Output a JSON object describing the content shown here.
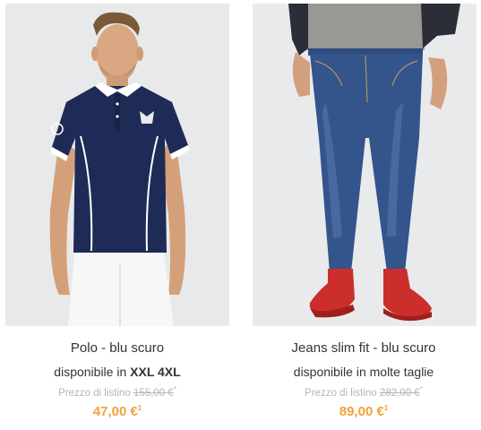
{
  "products": [
    {
      "title": "Polo - blu scuro",
      "availability_prefix": "disponibile in ",
      "availability_sizes": "XXL 4XL",
      "list_price_label": "Prezzo di listino",
      "list_price": "155,00 €",
      "list_price_mark": "*",
      "price": "47,00 €",
      "price_mark": "1",
      "image_icon": "polo-shirt-photo"
    },
    {
      "title": "Jeans slim fit - blu scuro",
      "availability_prefix": "disponibile in molte taglie",
      "availability_sizes": "",
      "list_price_label": "Prezzo di listino",
      "list_price": "282,00 €",
      "list_price_mark": "*",
      "price": "89,00 €",
      "price_mark": "1",
      "image_icon": "jeans-photo"
    }
  ],
  "colors": {
    "price": "#f0a23a",
    "list_price": "#b5b5b5",
    "text": "#333333",
    "photo_bg": "#e9eaec"
  }
}
